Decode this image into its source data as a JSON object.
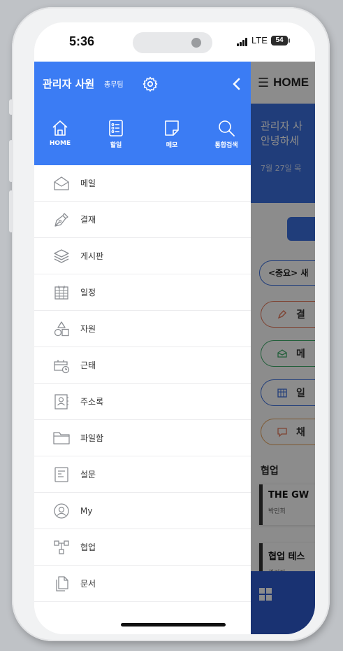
{
  "status_bar": {
    "time": "5:36",
    "network": "LTE",
    "battery": "54"
  },
  "drawer": {
    "user_name": "관리자 사원",
    "user_dept": "총무팀",
    "quick_links": [
      {
        "label": "HOME",
        "icon": "home-icon"
      },
      {
        "label": "할일",
        "icon": "checklist-icon"
      },
      {
        "label": "메모",
        "icon": "memo-icon"
      },
      {
        "label": "통합검색",
        "icon": "search-icon"
      }
    ],
    "menu_items": [
      {
        "label": "메일",
        "icon": "mail-icon"
      },
      {
        "label": "결재",
        "icon": "pen-icon"
      },
      {
        "label": "게시판",
        "icon": "layers-icon"
      },
      {
        "label": "일정",
        "icon": "calendar-icon"
      },
      {
        "label": "자원",
        "icon": "resource-icon"
      },
      {
        "label": "근태",
        "icon": "attendance-icon"
      },
      {
        "label": "주소록",
        "icon": "contacts-icon"
      },
      {
        "label": "파일함",
        "icon": "folder-icon"
      },
      {
        "label": "설문",
        "icon": "survey-icon"
      },
      {
        "label": "My",
        "icon": "user-icon"
      },
      {
        "label": "협업",
        "icon": "collaboration-icon"
      },
      {
        "label": "문서",
        "icon": "document-icon"
      }
    ]
  },
  "background_app": {
    "title": "HOME",
    "greeting_line1": "관리자 사",
    "greeting_line2": "안녕하세",
    "date": "7월 27일 목",
    "notice": "<중요> 새",
    "pills": [
      {
        "label": "결",
        "color": "#e6785a"
      },
      {
        "label": "메",
        "color": "#3fae6b"
      },
      {
        "label": "일",
        "color": "#3b6fde"
      },
      {
        "label": "채",
        "color": "#e6a25a"
      }
    ],
    "collab_title": "협업",
    "cards": [
      {
        "title": "THE GW",
        "sub": "박민희"
      },
      {
        "title": "협업 테스",
        "sub": "관리자"
      }
    ]
  }
}
